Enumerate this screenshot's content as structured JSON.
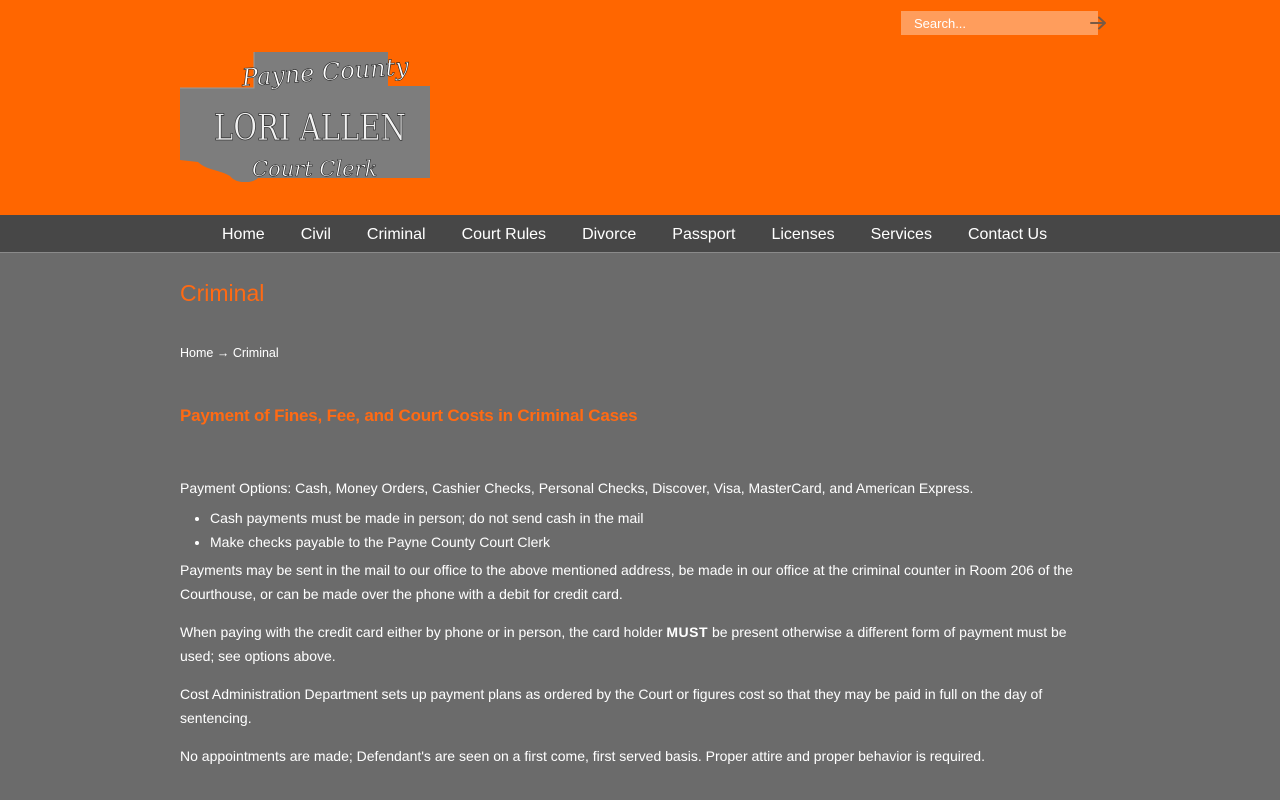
{
  "header": {
    "search_placeholder": "Search...",
    "logo": {
      "line1": "Payne County",
      "line2": "LORI ALLEN",
      "line3": "Court Clerk"
    }
  },
  "nav": {
    "items": [
      "Home",
      "Civil",
      "Criminal",
      "Court Rules",
      "Divorce",
      "Passport",
      "Licenses",
      "Services",
      "Contact Us"
    ]
  },
  "page": {
    "title": "Criminal",
    "breadcrumb": {
      "home": "Home",
      "separator": "→",
      "current": "Criminal"
    },
    "heading": "Payment of Fines, Fee, and Court Costs in Criminal Cases",
    "payment_options": "Payment Options: Cash, Money Orders, Cashier Checks, Personal Checks, Discover, Visa, MasterCard, and American Express.",
    "bullets": [
      "Cash payments must be made in person; do not send cash in the mail",
      "Make checks payable to the Payne County Court Clerk"
    ],
    "para_mail": "Payments may be sent in the mail to our office to the above mentioned address, be made in our office at the criminal counter in Room 206 of the Courthouse, or can be made over the phone with a debit for credit card.",
    "para_credit_before": "When paying with the credit card either by phone or in person, the card holder ",
    "para_credit_emph": "MUST",
    "para_credit_after": " be present otherwise a different form of payment must be used; see options above.",
    "para_cost": "Cost Administration Department sets up payment plans as ordered by the Court or figures cost so that they may be paid in full on the day of sentencing.",
    "para_appointments": "No appointments are made; Defendant's are seen on a first come, first served basis. Proper attire and proper behavior is required."
  },
  "colors": {
    "header_orange": "#ff6600",
    "accent_orange": "#ff6a13",
    "nav_bg": "#474747",
    "content_bg": "#6b6b6b"
  },
  "icons": {
    "search_submit": "arrow-right-icon"
  }
}
